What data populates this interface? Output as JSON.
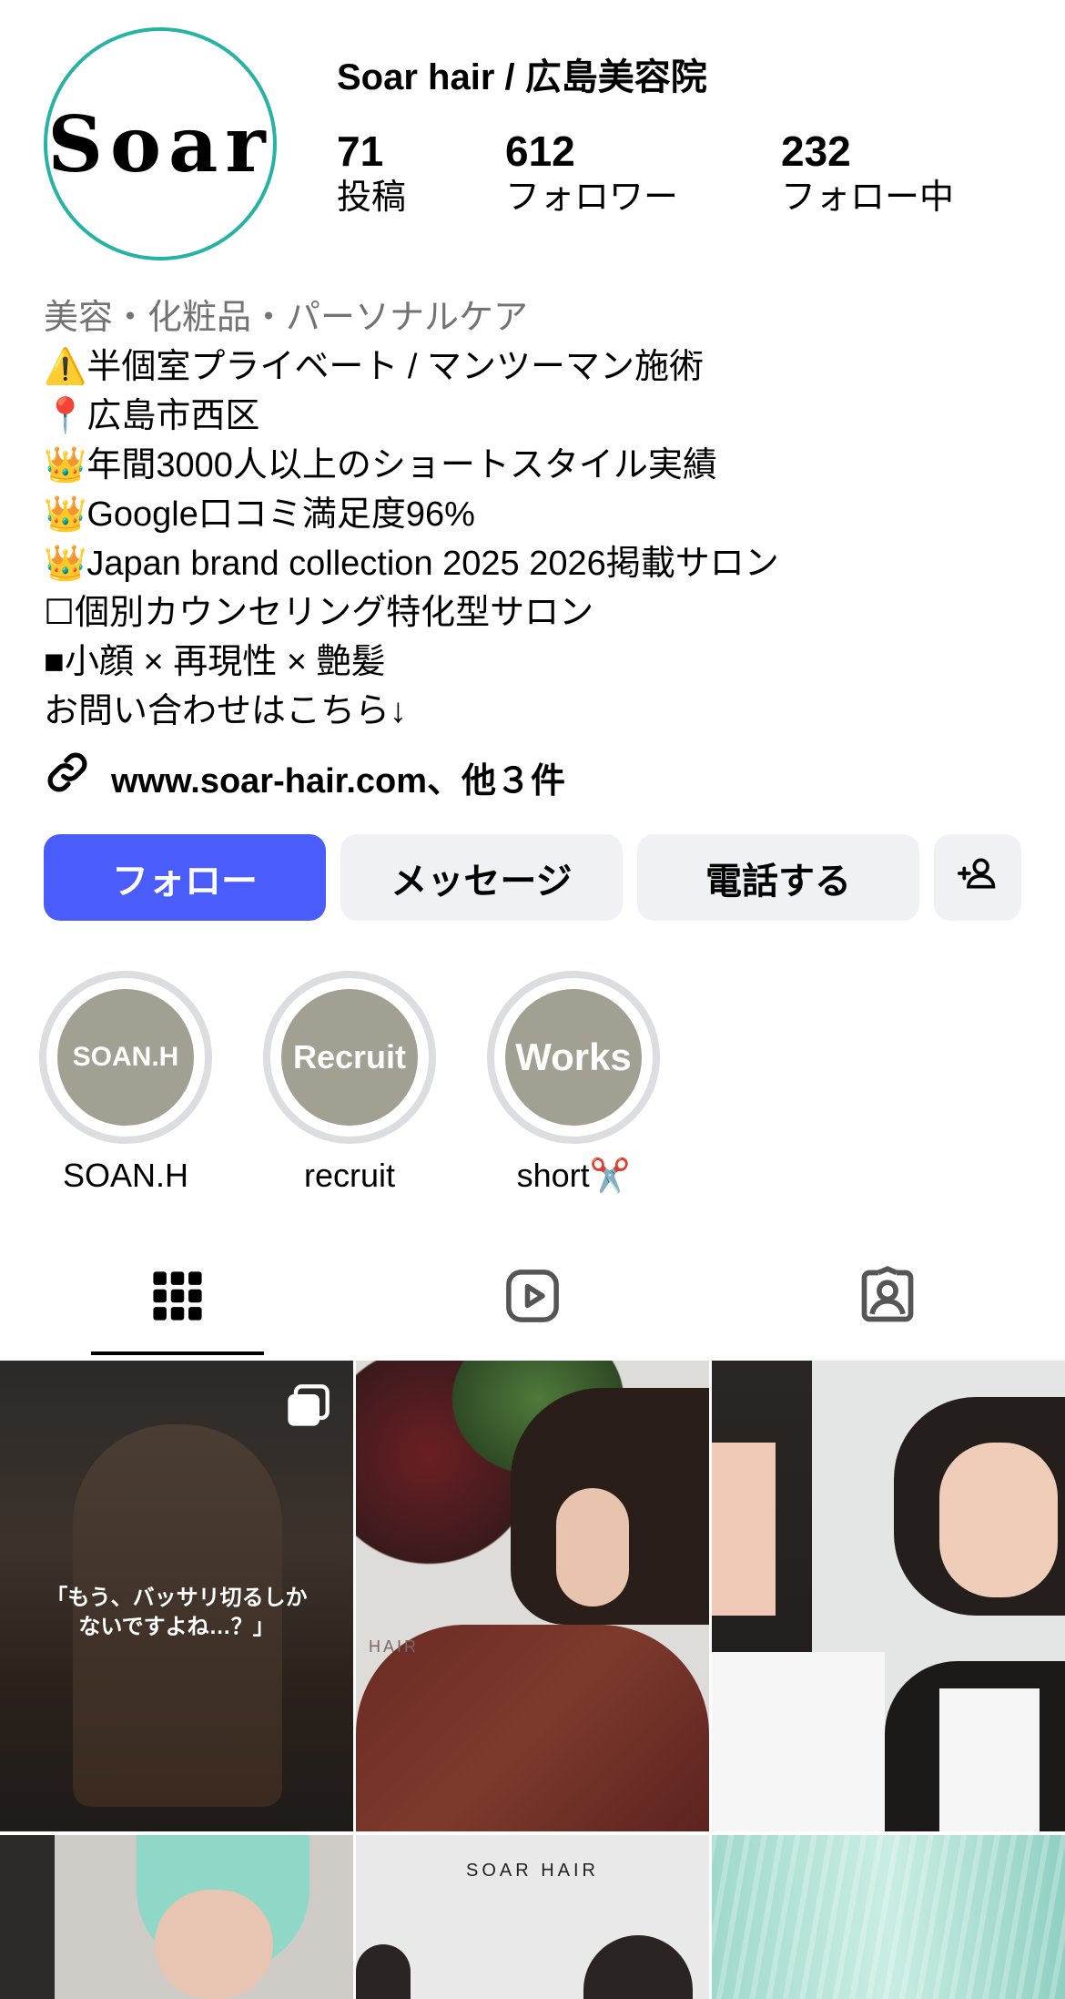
{
  "profile": {
    "avatar_text": "Soar",
    "username": "Soar hair / 広島美容院",
    "stats": [
      {
        "value": "71",
        "label": "投稿"
      },
      {
        "value": "612",
        "label": "フォロワー"
      },
      {
        "value": "232",
        "label": "フォロー中"
      }
    ]
  },
  "bio": {
    "category": "美容・化粧品・パーソナルケア",
    "lines": [
      "⚠️半個室プライベート / マンツーマン施術",
      "📍広島市西区",
      "👑年間3000人以上のショートスタイル実績",
      "👑Google口コミ満足度96%",
      "👑Japan brand collection 2025 2026掲載サロン",
      "☐個別カウンセリング特化型サロン",
      "■小顔 × 再現性 × 艶髪",
      "お問い合わせはこちら↓"
    ],
    "link": "www.soar-hair.com、他３件"
  },
  "buttons": {
    "follow": "フォロー",
    "message": "メッセージ",
    "call": "電話する"
  },
  "highlights": [
    {
      "cover": "SOAN.H",
      "name": "SOAN.H"
    },
    {
      "cover": "Recruit",
      "name": "recruit"
    },
    {
      "cover": "Works",
      "name": "short✂️"
    }
  ],
  "posts": [
    {
      "overlay": "「もう、バッサリ切るしか\nないですよね…？」"
    },
    {
      "overlay": "HAIR"
    },
    {
      "overlay": ""
    },
    {
      "overlay": ""
    },
    {
      "overlay": "SOAR HAIR"
    },
    {
      "overlay": ""
    }
  ],
  "colors": {
    "accent": "#4a5dfb",
    "avatar_ring": "#27b3a4",
    "secondary_button": "#eff1f4",
    "highlight_cover": "#a29f93"
  }
}
